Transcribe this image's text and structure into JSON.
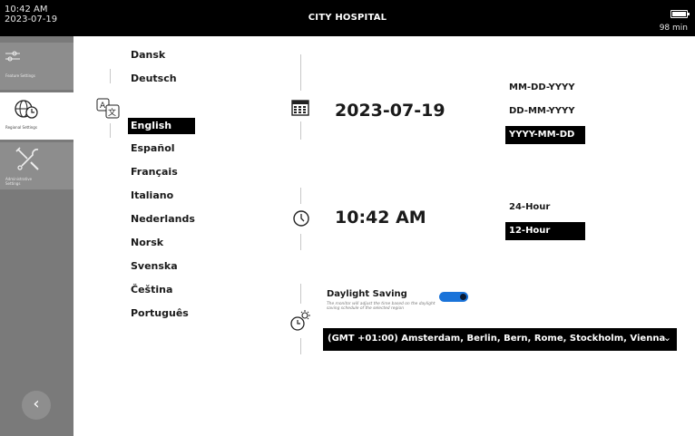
{
  "status_bar": {
    "time": "10:42 AM",
    "date": "2023-07-19",
    "title": "CITY HOSPITAL",
    "battery_text": "98 min"
  },
  "sidebar": {
    "items": [
      {
        "label": "Feature Settings",
        "icon": "sliders-icon",
        "active": false
      },
      {
        "label": "Regional Settings",
        "icon": "globe-clock-icon",
        "active": true
      },
      {
        "label": "Administrative Settings",
        "icon": "tools-icon",
        "active": false
      }
    ],
    "back_icon": "chevron-left-icon"
  },
  "languages": {
    "icon": "translate-icon",
    "items": [
      "Dansk",
      "Deutsch",
      "English",
      "Español",
      "Français",
      "Italiano",
      "Nederlands",
      "Norsk",
      "Svenska",
      "Čeština",
      "Português"
    ],
    "selected": "English"
  },
  "date": {
    "icon": "calendar-icon",
    "value": "2023-07-19",
    "formats": [
      "MM-DD-YYYY",
      "DD-MM-YYYY",
      "YYYY-MM-DD"
    ],
    "selected_format": "YYYY-MM-DD"
  },
  "time": {
    "icon": "clock-icon",
    "value": "10:42 AM",
    "formats": [
      "24-Hour",
      "12-Hour"
    ],
    "selected_format": "12-Hour"
  },
  "daylight": {
    "icon": "clock-sun-icon",
    "label": "Daylight Saving",
    "description": "The monitor will adjust the time based on the daylight saving schedule of the selected region",
    "enabled": true,
    "timezone": "(GMT +01:00) Amsterdam, Berlin, Bern, Rome, Stockholm, Vienna"
  },
  "colors": {
    "selected_bg": "#000000",
    "sidebar_bg": "#7a7a7a",
    "toggle_on": "#1a73d9"
  }
}
